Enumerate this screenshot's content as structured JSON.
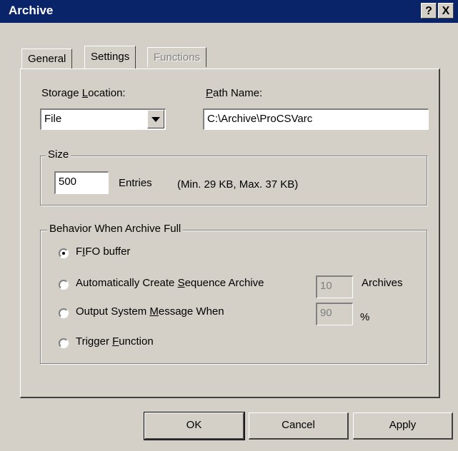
{
  "window": {
    "title": "Archive",
    "help_glyph": "?",
    "close_glyph": "X"
  },
  "tabs": [
    {
      "label": "General",
      "state": "normal"
    },
    {
      "label": "Settings",
      "state": "active"
    },
    {
      "label": "Functions",
      "state": "disabled"
    }
  ],
  "storage": {
    "label_pre": "Storage ",
    "label_u": "L",
    "label_post": "ocation:",
    "value": "File"
  },
  "path": {
    "label_u": "P",
    "label_post": "ath Name:",
    "value": "C:\\Archive\\ProCSVarc"
  },
  "size": {
    "group_title": "Size",
    "entries_value": "500",
    "entries_label": "Entries",
    "range_text": "(Min. 29 KB, Max. 37 KB)"
  },
  "behavior": {
    "group_title": "Behavior When Archive Full",
    "options": [
      {
        "pre": "F",
        "u": "I",
        "post": "FO buffer",
        "checked": true
      },
      {
        "pre": "Automatically Create ",
        "u": "S",
        "post": "equence Archive",
        "checked": false
      },
      {
        "pre": "Output System ",
        "u": "M",
        "post": "essage When",
        "checked": false
      },
      {
        "pre": "Trigger ",
        "u": "F",
        "post": "unction",
        "checked": false
      }
    ],
    "archives_value": "10",
    "archives_label": "Archives",
    "percent_value": "90",
    "percent_label": "%"
  },
  "buttons": {
    "ok": "OK",
    "cancel": "Cancel",
    "apply": "Apply"
  },
  "colors": {
    "titlebar": "#0a246a",
    "face": "#d4d0c8"
  }
}
